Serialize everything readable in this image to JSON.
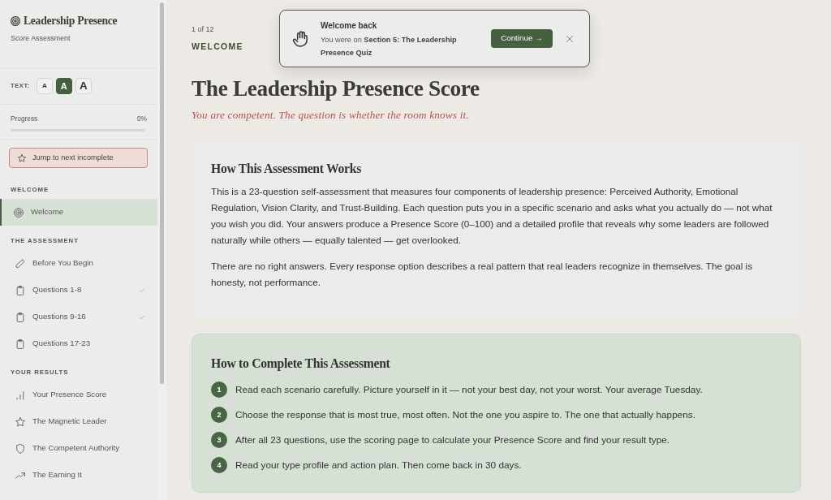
{
  "sidebar": {
    "brand": {
      "title": "Leadership Presence",
      "subtitle": "Score Assessment"
    },
    "text_size": {
      "label": "TEXT:",
      "options": [
        {
          "label": "A",
          "kind": "small",
          "selected": false
        },
        {
          "label": "A",
          "kind": "medium",
          "selected": true
        },
        {
          "label": "A",
          "kind": "large",
          "selected": false
        }
      ]
    },
    "progress": {
      "label": "Progress",
      "reading": "0%"
    },
    "jump_button": {
      "label": "Jump to next incomplete"
    },
    "sections": [
      {
        "title": "WELCOME",
        "items": [
          {
            "label": "Welcome",
            "kind": "target",
            "selected": true,
            "completed": false
          }
        ]
      },
      {
        "title": "THE ASSESSMENT",
        "items": [
          {
            "label": "Before You Begin",
            "kind": "pencil",
            "selected": false,
            "completed": false
          },
          {
            "label": "Questions 1-8",
            "kind": "clipboard",
            "selected": false,
            "completed": true
          },
          {
            "label": "Questions 9-16",
            "kind": "clipboard",
            "selected": false,
            "completed": true
          },
          {
            "label": "Questions 17-23",
            "kind": "clipboard",
            "selected": false,
            "completed": false
          }
        ]
      },
      {
        "title": "YOUR RESULTS",
        "items": [
          {
            "label": "Your Presence Score",
            "kind": "chart",
            "selected": false,
            "completed": false
          },
          {
            "label": "The Magnetic Leader",
            "kind": "star",
            "selected": false,
            "completed": false
          },
          {
            "label": "The Competent Authority",
            "kind": "shield",
            "selected": false,
            "completed": false
          },
          {
            "label": "The Earning It",
            "kind": "trend",
            "selected": false,
            "completed": false
          }
        ]
      }
    ]
  },
  "header": {
    "step": "1 of 12",
    "section": "WELCOME",
    "title": "The Leadership Presence Score",
    "tagline": "You are competent. The question is whether the room knows it."
  },
  "toast": {
    "title": "Welcome back",
    "message": "You were on **Section 5: The Leadership Presence Quiz**",
    "button": "Continue →"
  },
  "cards": [
    {
      "kind": "text",
      "heading": "How This Assessment Works",
      "paragraphs": [
        "This is a 23-question self-assessment that measures four components of leadership presence: Perceived Authority, Emotional Regulation, Vision Clarity, and Trust-Building. Each question puts you in a specific scenario and asks what you actually do — not what you wish you did. Your answers produce a Presence Score (0–100) and a detailed profile that reveals why some leaders are followed naturally while others — equally talented — get overlooked.",
        "There are no right answers. Every response option describes a real pattern that real leaders recognize in themselves. The goal is honesty, not performance."
      ]
    },
    {
      "kind": "steps",
      "heading": "How to Complete This Assessment",
      "steps": [
        {
          "number": "1",
          "text": "Read each scenario carefully. Picture yourself in it — not your best day, not your worst. Your average Tuesday."
        },
        {
          "number": "2",
          "text": "Choose the response that is most true, most often. Not the one you aspire to. The one that actually happens."
        },
        {
          "number": "3",
          "text": "After all 23 questions, use the scoring page to calculate your Presence Score and find your result type."
        },
        {
          "number": "4",
          "text": "Read your type profile and action plan. Then come back in 30 days."
        }
      ]
    }
  ]
}
